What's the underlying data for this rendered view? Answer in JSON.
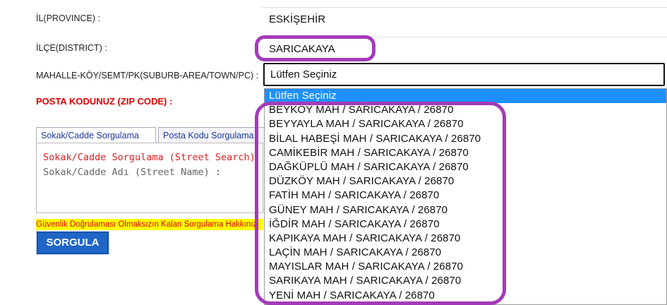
{
  "form": {
    "province": {
      "label": "İL(PROVINCE) :",
      "value": "ESKİŞEHİR"
    },
    "district": {
      "label": "İLÇE(DISTRICT) :",
      "value": "SARICAKAYA"
    },
    "suburb": {
      "label": "MAHALLE-KÖY/SEMT/PK(SUBURB-AREA/TOWN/PC) :",
      "selected": "Lütfen Seçiniz"
    },
    "zip_label": "POSTA KODUNUZ (ZIP CODE) :"
  },
  "dropdown": {
    "options": [
      "Lütfen Seçiniz",
      "BEYKÖY MAH / SARICAKAYA / 26870",
      "BEYYAYLA MAH / SARICAKAYA / 26870",
      "BİLAL HABEŞİ MAH / SARICAKAYA / 26870",
      "CAMİKEBİR MAH / SARICAKAYA / 26870",
      "DAĞKÜPLÜ MAH / SARICAKAYA / 26870",
      "DÜZKÖY MAH / SARICAKAYA / 26870",
      "FATİH MAH / SARICAKAYA / 26870",
      "GÜNEY MAH / SARICAKAYA / 26870",
      "İĞDİR MAH / SARICAKAYA / 26870",
      "KAPIKAYA MAH / SARICAKAYA / 26870",
      "LAÇİN MAH / SARICAKAYA / 26870",
      "MAYISLAR MAH / SARICAKAYA / 26870",
      "SARIKAYA MAH / SARICAKAYA / 26870",
      "YENİ MAH / SARICAKAYA / 26870"
    ],
    "highlight_color": "#1e90ff"
  },
  "tabs": [
    {
      "label": "Sokak/Cadde Sorgulama"
    },
    {
      "label": "Posta Kodu Sorgulama"
    }
  ],
  "panel": {
    "title": "Sokak/Cadde Sorgulama (Street Search)",
    "street_label": "Sokak/Cadde Adı (Street Name) :"
  },
  "warning": "Güvenlik Doğrulaması Olmaksızın Kalan Sorgulama Hakkınız",
  "search_button": "SORGULA",
  "annotation_color": "#a33bb8"
}
